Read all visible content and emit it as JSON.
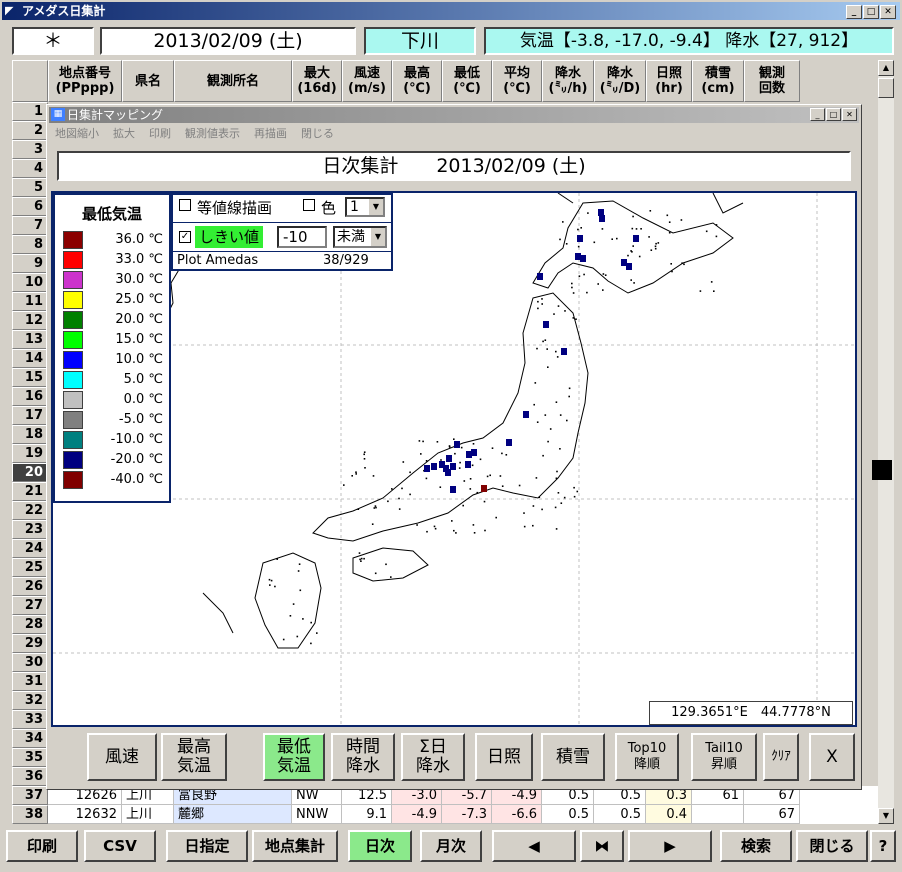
{
  "window": {
    "title": "アメダス日集計"
  },
  "header": {
    "star": "＊",
    "date": "2013/02/09 (土)",
    "station": "下川",
    "summary": "気温【-3.8, -17.0, -9.4】 降水【27, 912】"
  },
  "columns": [
    {
      "l1": "地点番号",
      "l2": "(PPppp)"
    },
    {
      "l1": "県名",
      "l2": ""
    },
    {
      "l1": "観測所名",
      "l2": ""
    },
    {
      "l1": "最大",
      "l2": "(16d)"
    },
    {
      "l1": "風速",
      "l2": "(m/s)"
    },
    {
      "l1": "最高",
      "l2": "(℃)"
    },
    {
      "l1": "最低",
      "l2": "(℃)"
    },
    {
      "l1": "平均",
      "l2": "(℃)"
    },
    {
      "l1": "降水",
      "l2": "(㍉/h)"
    },
    {
      "l1": "降水",
      "l2": "(㍉/D)"
    },
    {
      "l1": "日照",
      "l2": "(hr)"
    },
    {
      "l1": "積雪",
      "l2": "(cm)"
    },
    {
      "l1": "観測",
      "l2": "回数"
    }
  ],
  "rows": [
    {
      "num": "37",
      "id": "12626",
      "pref": "上川",
      "name": "富良野",
      "dir": "NW",
      "wind": "12.5",
      "max": "-3.0",
      "min": "-5.7",
      "avg": "-4.9",
      "p1": "0.5",
      "p2": "0.5",
      "sun": "0.3",
      "snow": "61",
      "cnt": "67"
    },
    {
      "num": "38",
      "id": "12632",
      "pref": "上川",
      "name": "麓郷",
      "dir": "NNW",
      "wind": "9.1",
      "max": "-4.9",
      "min": "-7.3",
      "avg": "-6.6",
      "p1": "0.5",
      "p2": "0.5",
      "sun": "0.4",
      "snow": "",
      "cnt": "67"
    }
  ],
  "rownumbers": [
    "1",
    "2",
    "3",
    "4",
    "5",
    "6",
    "7",
    "8",
    "9",
    "10",
    "11",
    "12",
    "13",
    "14",
    "15",
    "16",
    "17",
    "18",
    "19",
    "20",
    "21",
    "22",
    "23",
    "24",
    "25",
    "26",
    "27",
    "28",
    "29",
    "30",
    "31",
    "32",
    "33",
    "34",
    "35",
    "36"
  ],
  "selected_row": "20",
  "bottom_buttons": [
    "印刷",
    "CSV",
    "日指定",
    "地点集計",
    "日次",
    "月次",
    "◀",
    "⧓",
    "▶",
    "検索",
    "閉じる",
    "?"
  ],
  "map": {
    "title": "日集計マッピング",
    "menu": [
      "地図縮小",
      "拡大",
      "印刷",
      "観測値表示",
      "再描画",
      "閉じる"
    ],
    "heading": "日次集計　　2013/02/09 (土)",
    "legend_title": "最低気温",
    "legend": [
      {
        "c": "#8b0000",
        "v": "36.0 ℃"
      },
      {
        "c": "#ff0000",
        "v": "33.0 ℃"
      },
      {
        "c": "#cc33cc",
        "v": "30.0 ℃"
      },
      {
        "c": "#ffff00",
        "v": "25.0 ℃"
      },
      {
        "c": "#008000",
        "v": "20.0 ℃"
      },
      {
        "c": "#00ff00",
        "v": "15.0 ℃"
      },
      {
        "c": "#0000ff",
        "v": "10.0 ℃"
      },
      {
        "c": "#00ffff",
        "v": "5.0 ℃"
      },
      {
        "c": "#c0c0c0",
        "v": "0.0 ℃"
      },
      {
        "c": "#808080",
        "v": "-5.0 ℃"
      },
      {
        "c": "#008080",
        "v": "-10.0 ℃"
      },
      {
        "c": "#000080",
        "v": "-20.0 ℃"
      },
      {
        "c": "#800000",
        "v": "-40.0 ℃"
      }
    ],
    "contour_label": "等値線描画",
    "color_label": "色",
    "color_value": "1",
    "threshold_label": "しきい値",
    "threshold_value": "-10",
    "threshold_mode": "未満",
    "plot_label": "Plot Amedas",
    "plot_count": "38/929",
    "coords": "129.3651°E　44.7778°N",
    "buttons": [
      "風速",
      "最高|気温",
      "最低|気温",
      "時間|降水",
      "Σ日|降水",
      "日照",
      "積雪",
      "Top10|降順",
      "Tail10|昇順",
      "ｸﾘｱ",
      "X"
    ]
  }
}
